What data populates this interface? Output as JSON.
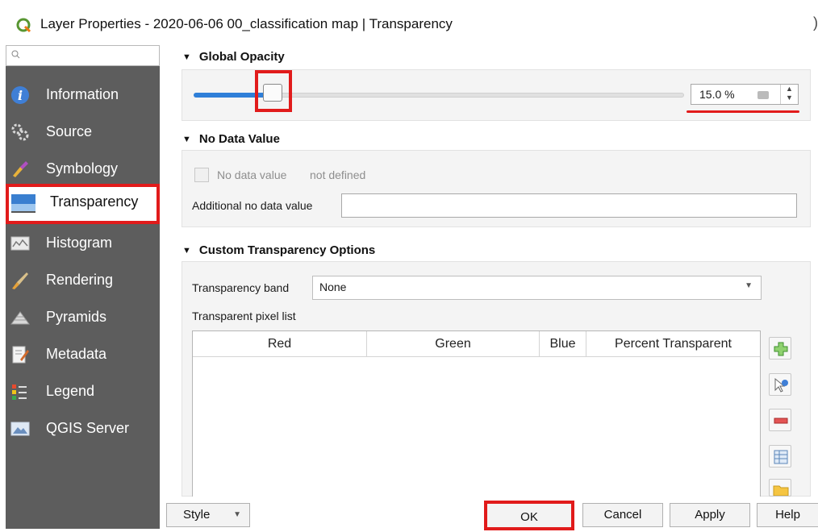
{
  "window": {
    "title": "Layer Properties - 2020-06-06 00_classification map | Transparency",
    "close_glyph": ")"
  },
  "sidebar": {
    "search_placeholder": "",
    "items": [
      {
        "label": "Information",
        "icon": "information-icon"
      },
      {
        "label": "Source",
        "icon": "source-icon"
      },
      {
        "label": "Symbology",
        "icon": "symbology-icon"
      },
      {
        "label": "Transparency",
        "icon": "transparency-icon",
        "active": true
      },
      {
        "label": "Histogram",
        "icon": "histogram-icon"
      },
      {
        "label": "Rendering",
        "icon": "rendering-icon"
      },
      {
        "label": "Pyramids",
        "icon": "pyramids-icon"
      },
      {
        "label": "Metadata",
        "icon": "metadata-icon"
      },
      {
        "label": "Legend",
        "icon": "legend-icon"
      },
      {
        "label": "QGIS Server",
        "icon": "qgis-server-icon"
      }
    ]
  },
  "global_opacity": {
    "heading": "Global Opacity",
    "value_text": "15.0 %",
    "slider_fraction": 0.15
  },
  "no_data": {
    "heading": "No Data Value",
    "checkbox_label": "No data value",
    "checkbox_status": "not defined",
    "additional_label": "Additional no data value",
    "additional_value": ""
  },
  "custom_transparency": {
    "heading": "Custom Transparency Options",
    "band_label": "Transparency band",
    "band_value": "None",
    "pixel_list_label": "Transparent pixel list",
    "columns": [
      "Red",
      "Green",
      "Blue",
      "Percent Transparent"
    ]
  },
  "buttons": {
    "style": "Style",
    "ok": "OK",
    "cancel": "Cancel",
    "apply": "Apply",
    "help": "Help"
  },
  "colors": {
    "sidebar_bg": "#5d5d5d",
    "highlight_red": "#e11b1b",
    "slider_blue": "#2f7fd8"
  }
}
